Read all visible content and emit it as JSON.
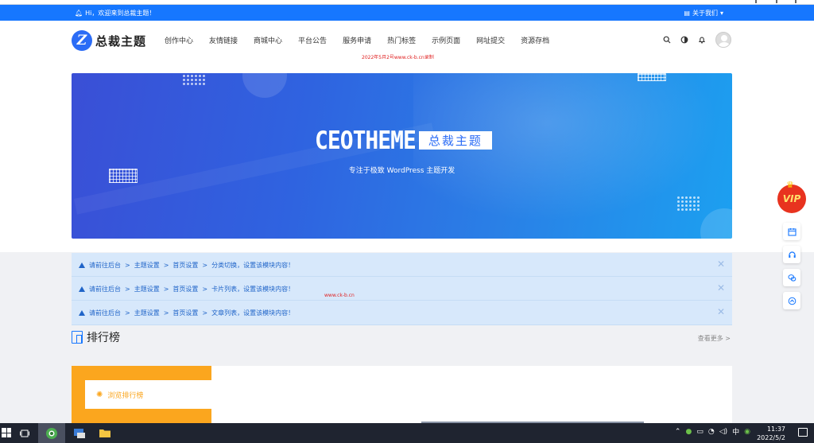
{
  "announcement": {
    "greeting": "Hi，欢迎来到总裁主题！",
    "about_link": "关于我们"
  },
  "header": {
    "logo_mark": "Z",
    "logo_text": "总裁主题",
    "nav": [
      "创作中心",
      "友情链接",
      "商城中心",
      "平台公告",
      "服务申请",
      "热门标签",
      "示例页面",
      "网址提交",
      "资源存档"
    ],
    "icons": [
      "search-icon",
      "theme-toggle-icon",
      "bell-icon",
      "avatar"
    ]
  },
  "watermarks": {
    "top": "2022年5月2号www.ck-b.cn录制",
    "middle": "www.ck-b.cn"
  },
  "banner": {
    "title_en": "CEOTHEME",
    "title_cn": "总裁主题",
    "subtitle": "专注于极致 WordPress 主题开发"
  },
  "notices": [
    {
      "prefix": "请前往后台",
      "path": [
        "主题设置",
        "首页设置",
        "分类切换，设置该模块内容！"
      ]
    },
    {
      "prefix": "请前往后台",
      "path": [
        "主题设置",
        "首页设置",
        "卡片列表，设置该模块内容！"
      ]
    },
    {
      "prefix": "请前往后台",
      "path": [
        "主题设置",
        "首页设置",
        "文章列表，设置该模块内容！"
      ]
    }
  ],
  "ranking": {
    "title": "排行榜",
    "more": "查看更多 >",
    "card_label": "浏览排行榜"
  },
  "side": {
    "vip": "VIP",
    "buttons": [
      "calendar-icon",
      "headset-icon",
      "wechat-icon",
      "scroll-top-icon"
    ]
  },
  "taskbar": {
    "ime": "中",
    "time": "11:37",
    "date": "2022/5/2"
  },
  "colors": {
    "brand_blue": "#1677ff",
    "notice_bg": "#d7e8fb",
    "rank_orange": "#fba61e",
    "vip_red": "#e8331f"
  }
}
